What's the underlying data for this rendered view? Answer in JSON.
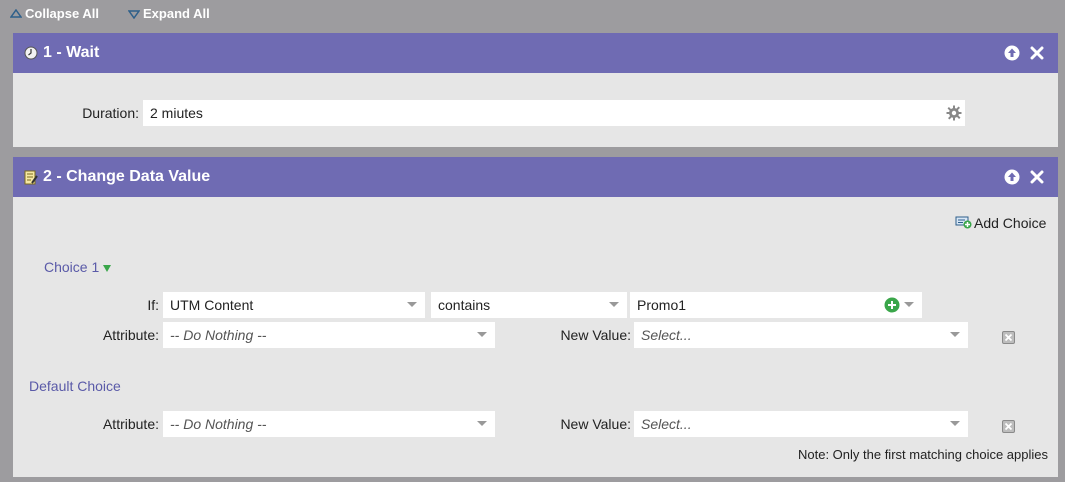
{
  "toolbar": {
    "collapse_all": "Collapse All",
    "expand_all": "Expand All"
  },
  "step1": {
    "title": "1 - Wait",
    "duration_label": "Duration:",
    "duration_value": "2 miutes"
  },
  "step2": {
    "title": "2 - Change Data Value",
    "add_choice": "Add Choice",
    "choice1": {
      "title": "Choice 1",
      "if_label": "If:",
      "if_field": "UTM Content",
      "operator": "contains",
      "value": "Promo1",
      "attribute_label": "Attribute:",
      "attribute_value": "-- Do Nothing --",
      "new_value_label": "New Value:",
      "new_value_placeholder": "Select..."
    },
    "default_choice": {
      "title": "Default Choice",
      "attribute_label": "Attribute:",
      "attribute_value": "-- Do Nothing --",
      "new_value_label": "New Value:",
      "new_value_placeholder": "Select..."
    },
    "note": "Note: Only the first matching choice applies"
  },
  "colors": {
    "header": "#6f6bb3",
    "background": "#9d9c9f",
    "panel": "#e6e6e6",
    "link": "#5a5aa8",
    "add_green": "#3aa64a"
  }
}
